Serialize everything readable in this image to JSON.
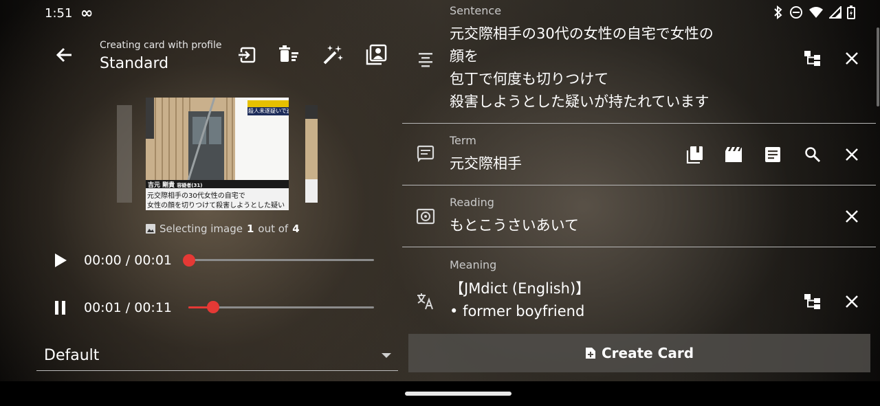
{
  "status_bar": {
    "time": "1:51",
    "infinity": "∞"
  },
  "header": {
    "profile_label": "Creating card with profile",
    "profile_name": "Standard"
  },
  "image_picker": {
    "caption_prefix": "Selecting image",
    "current": "1",
    "caption_mid": "out of",
    "total": "4",
    "overlay_name": "吉元 剛貴",
    "overlay_suffix": "容疑者(31)",
    "overlay_line1": "元交際相手の30代女性の自宅で",
    "overlay_line2": "女性の顔を切りつけて殺害しようとした疑い",
    "overlay_top": "殺人未遂疑いで逮"
  },
  "audio": [
    {
      "time": "00:00 / 00:01",
      "state": "play",
      "progress": 0.0
    },
    {
      "time": "00:01 / 00:11",
      "state": "pause",
      "progress": 0.13
    }
  ],
  "deck": {
    "selected": "Default"
  },
  "fields": {
    "sentence": {
      "label": "Sentence",
      "lines": [
        "元交際相手の30代の女性の自宅で女性の",
        "顔を",
        "包丁で何度も切りつけて",
        "殺害しようとした疑いが持たれています"
      ]
    },
    "term": {
      "label": "Term",
      "value": "元交際相手"
    },
    "reading": {
      "label": "Reading",
      "value": "もとこうさいあいて"
    },
    "meaning": {
      "label": "Meaning",
      "line1": "【JMdict (English)】",
      "line2": "• former boyfriend"
    }
  },
  "create_button": {
    "label": "Create Card"
  },
  "colors": {
    "accent": "#e53935",
    "divider": "#b8b8b8"
  }
}
